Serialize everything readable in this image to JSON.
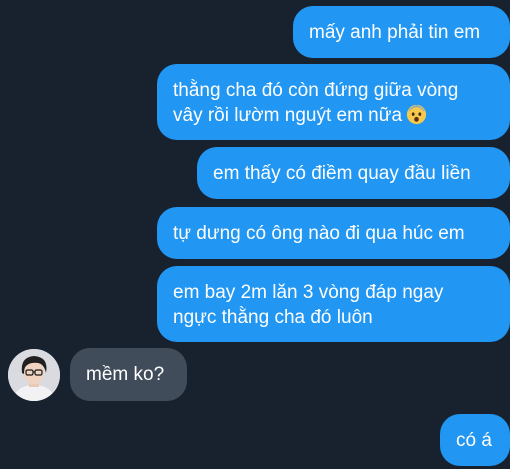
{
  "chat": {
    "messages": [
      {
        "side": "outgoing",
        "text": "mấy anh phải tin em"
      },
      {
        "side": "outgoing",
        "line1": "thằng cha đó còn đứng giữa vòng",
        "line2": "vây rồi lườm nguýt em nữa",
        "emoji": "fearful-face-icon"
      },
      {
        "side": "outgoing",
        "text": "em thấy có điềm quay đầu liền"
      },
      {
        "side": "outgoing",
        "text": "tự dưng có ông nào đi qua húc em"
      },
      {
        "side": "outgoing",
        "line1": "em bay 2m lăn 3 vòng đáp ngay",
        "line2": "ngực thằng cha đó luôn"
      },
      {
        "side": "incoming",
        "text": "mềm ko?",
        "avatar": "contact-avatar"
      },
      {
        "side": "outgoing",
        "text": "có á"
      }
    ]
  },
  "colors": {
    "background": "#18212e",
    "outgoing_bubble": "#2196f3",
    "incoming_bubble": "#414c5b",
    "text": "#ffffff"
  }
}
